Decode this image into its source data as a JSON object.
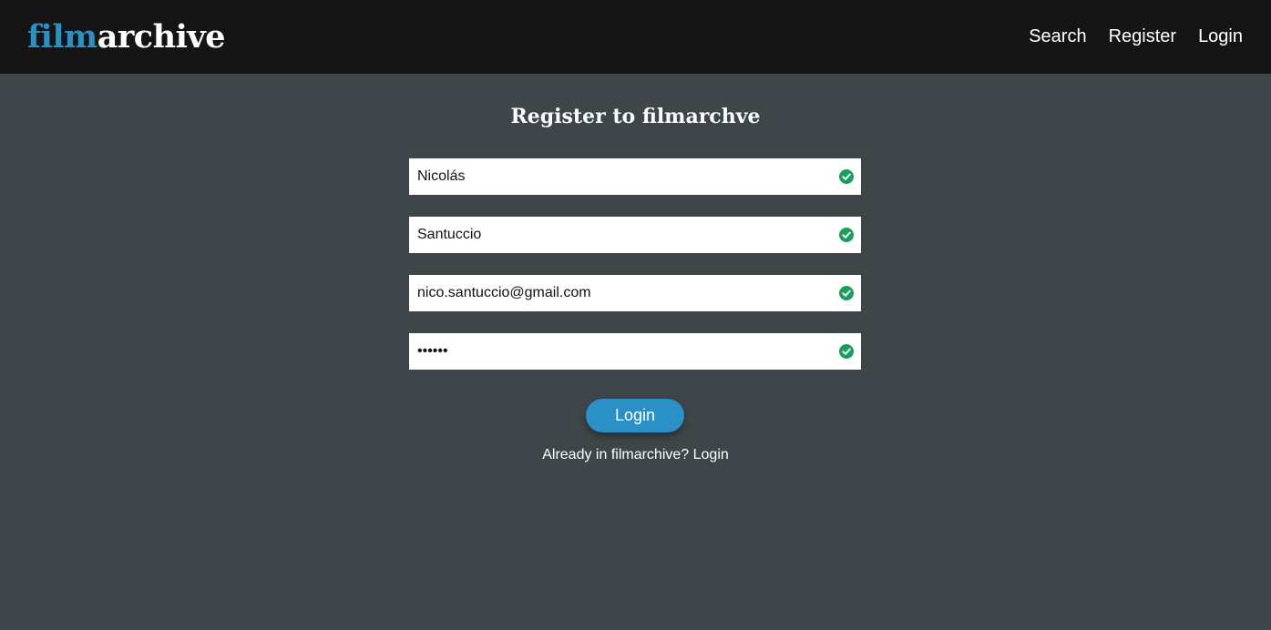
{
  "header": {
    "logo_part1": "film",
    "logo_part2": "archive",
    "nav": {
      "search": "Search",
      "register": "Register",
      "login": "Login"
    }
  },
  "form": {
    "title": "Register to filmarchve",
    "first_name": "Nicolás",
    "last_name": "Santuccio",
    "email": "nico.santuccio@gmail.com",
    "password": "••••••",
    "submit_label": "Login",
    "already_text": "Already in filmarchive?",
    "already_link": "Login"
  },
  "colors": {
    "brand_blue": "#2b90c6",
    "valid_green": "#1a9e5c",
    "navbar_bg": "#151515",
    "page_bg": "#3f4649"
  },
  "icons": {
    "valid": "check-circle-icon"
  }
}
